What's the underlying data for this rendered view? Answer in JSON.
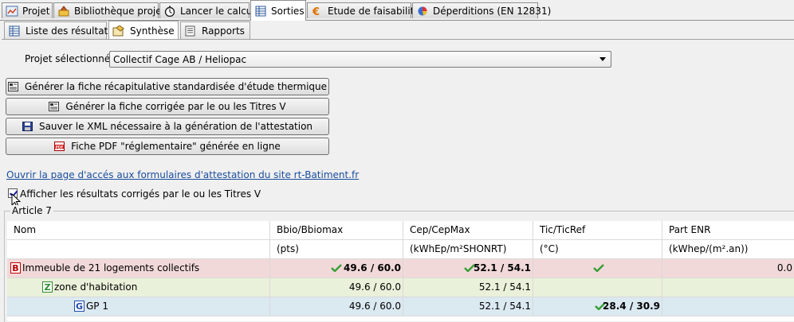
{
  "tabs": [
    {
      "label": "Projet",
      "icon": "project-icon"
    },
    {
      "label": "Bibliothèque projet",
      "icon": "library-icon"
    },
    {
      "label": "Lancer le calcul",
      "icon": "stopwatch-icon"
    },
    {
      "label": "Sorties",
      "icon": "table-icon",
      "active": true
    },
    {
      "label": "Etude de faisabilité",
      "icon": "euro-icon"
    },
    {
      "label": "Déperditions (EN 12831)",
      "icon": "pie-icon"
    }
  ],
  "subtabs": [
    {
      "label": "Liste des résultats",
      "icon": "list-icon"
    },
    {
      "label": "Synthèse",
      "icon": "synthesis-icon",
      "active": true
    },
    {
      "label": "Rapports",
      "icon": "report-icon"
    }
  ],
  "project": {
    "label": "Projet sélectionné :",
    "value": "Collectif Cage AB  /  Heliopac"
  },
  "buttons": [
    {
      "label": "Générer la fiche récapitulative standardisée d'étude thermique",
      "icon": "document-icon"
    },
    {
      "label": "Générer la fiche corrigée par le ou les Titres V",
      "icon": "document-icon"
    },
    {
      "label": "Sauver le XML nécessaire à la génération de l'attestation",
      "icon": "floppy-disk-icon"
    },
    {
      "label": "Fiche PDF \"réglementaire\" générée en ligne",
      "icon": "pdf-icon"
    }
  ],
  "link": "Ouvrir la page d'accés aux formulaires d'attestation du site rt-Batiment.fr",
  "checkbox": {
    "label": "Afficher les résultats corrigés par le ou les Titres V",
    "checked": true
  },
  "group_title": "Article 7",
  "table": {
    "headers": [
      "Nom",
      "Bbio/Bbiomax",
      "Cep/CepMax",
      "Tic/TicRef",
      "Part ENR"
    ],
    "units": [
      "",
      "(pts)",
      "(kWhEp/m²SHONRT)",
      "(°C)",
      "(kWhep/(m².an))"
    ],
    "rows": [
      {
        "badge": "B",
        "name": "Immeuble de 21 logements collectifs",
        "bbio": "49.6 /  60.0",
        "cep": "52.1 /  54.1",
        "tic": "",
        "enr": "0.0",
        "bbio_ok": true,
        "cep_ok": true,
        "tic_ok": true
      },
      {
        "badge": "Z",
        "name": "zone d'habitation",
        "bbio": "49.6 /  60.0",
        "cep": "52.1 /  54.1",
        "tic": "",
        "enr": ""
      },
      {
        "badge": "G",
        "name": "GP 1",
        "bbio": "49.6 /  60.0",
        "cep": "52.1 /  54.1",
        "tic": "28.4 /  30.9",
        "enr": "",
        "tic_ok": true
      }
    ]
  },
  "colors": {
    "row_building": "#f2d9d9",
    "row_zone": "#eaf1da",
    "row_group": "#dbe9f1",
    "check_green": "#3aa03a",
    "link": "#1a4d9e"
  }
}
